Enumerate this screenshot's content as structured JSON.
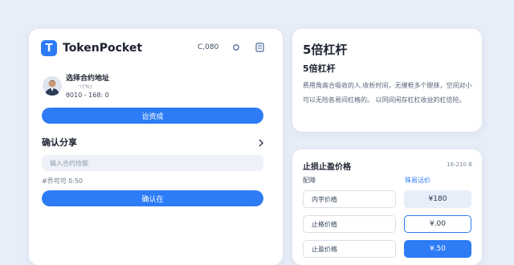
{
  "wallet": {
    "brand_letter": "T",
    "brand_name": "TokenPocket",
    "header_value": "C,080",
    "account_title": "选择合约地址",
    "account_sub": "ㄱ(%)",
    "account_address": "θ010 - 168: 0",
    "primary_button": "诒资成",
    "section_title": "确认分享",
    "input_placeholder": "输入合约炝额",
    "balance_text": "#乔可可 δ:50",
    "confirm_button": "确认在",
    "colors": {
      "accent": "#2d7cf6",
      "background": "#e8eef8"
    }
  },
  "info": {
    "heading": "5倍杠杆",
    "subheading": "5倍杠杆",
    "body": "费用角高合吸收的人.收析时间，无撲框多个眼抹，空间对小可以无险各易间杠格的。 以同间闲存杠杠收益的杠倍险。"
  },
  "order": {
    "title": "止损止盈价格",
    "range": "16-210 B",
    "col_left": "配陣",
    "col_right": "殊易话价",
    "rows": [
      {
        "label": "内字价植",
        "value": "¥180"
      },
      {
        "label": "止格价植",
        "value": "¥.00"
      },
      {
        "label": "止盈价格",
        "value": "¥.50"
      }
    ]
  }
}
